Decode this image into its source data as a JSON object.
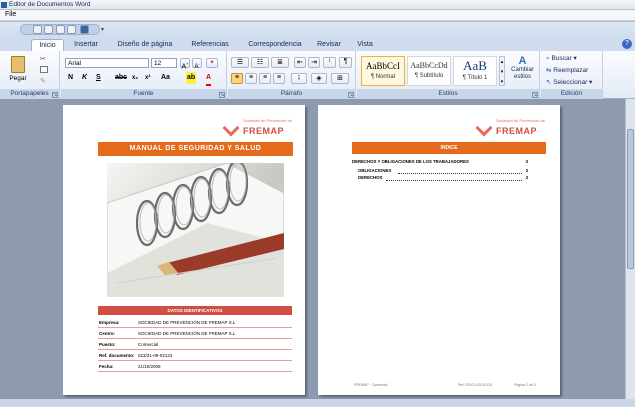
{
  "window": {
    "title": "Editor de Documentos Word"
  },
  "menu": {
    "file": "File"
  },
  "tabs": [
    "Inicio",
    "Insertar",
    "Diseño de página",
    "Referencias",
    "Correspondencia",
    "Revisar",
    "Vista"
  ],
  "help": "?",
  "ribbon": {
    "clipboard": {
      "label": "Portapapeles",
      "paste": "Pegar"
    },
    "font": {
      "label": "Fuente",
      "name": "Arial",
      "size": "12"
    },
    "paragraph": {
      "label": "Párrafo"
    },
    "styles": {
      "label": "Estilos",
      "items": [
        {
          "preview": "AaBbCcI",
          "name": "¶ Normal"
        },
        {
          "preview": "AaBbCcDd",
          "name": "¶ Subtítulo"
        },
        {
          "preview": "AaB",
          "name": "¶ Título 1"
        }
      ],
      "change": "Cambiar estilos"
    },
    "editing": {
      "label": "Edición",
      "find": "Buscar",
      "replace": "Reemplazar",
      "select": "Seleccionar"
    }
  },
  "doc1": {
    "logo_small": "Sociedad de Prevención de",
    "logo_big": "FREMAP",
    "title": "MANUAL DE SEGURIDAD Y SALUD",
    "datos_title": "DATOS IDENTIFICATIVOS",
    "rows": [
      {
        "k": "Empresa:",
        "v": "SOCIEDAD DE PREVENCIÓN DE FREMAP S.L"
      },
      {
        "k": "Centro:",
        "v": "SOCIEDAD DE PREVENCIÓN DE FREMAP S.L"
      },
      {
        "k": "Puesto:",
        "v": "Comercial"
      },
      {
        "k": "Ref. documento:",
        "v": "023/21-09-02123"
      },
      {
        "k": "Fecha:",
        "v": "21/10/2009"
      }
    ]
  },
  "doc2": {
    "logo_small": "Sociedad de Prevención de",
    "logo_big": "FREMAP",
    "title": "INDICE",
    "toc": [
      {
        "text": "DERECHOS Y OBLIGACIONES DE LOS TRABAJADORES",
        "page": "3"
      },
      {
        "text": "OBLIGACIONES",
        "page": "3"
      },
      {
        "text": "DERECHOS",
        "page": "3"
      }
    ],
    "footer_left": "FREMAP · Comercial",
    "footer_mid": "Ref: 023/21-09-02123",
    "footer_right": "Página 2 de 3"
  }
}
